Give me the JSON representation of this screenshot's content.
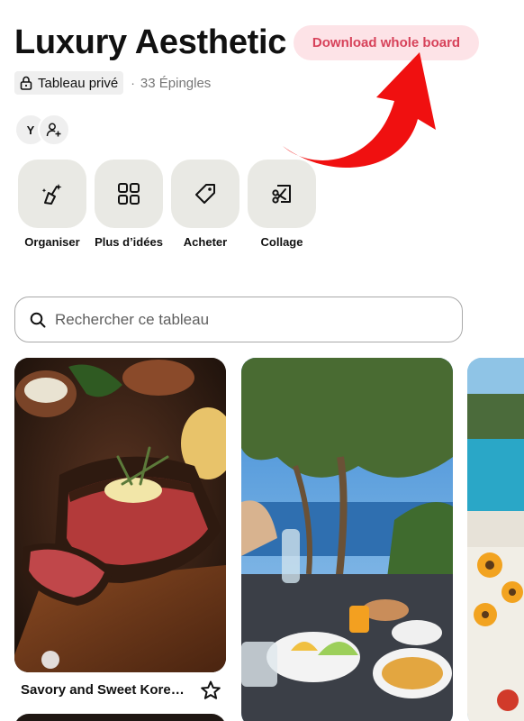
{
  "board": {
    "title": "Luxury Aesthetic",
    "download_label": "Download whole board",
    "privacy_label": "Tableau privé",
    "separator": "·",
    "pin_count_label": "33 Épingles",
    "collaborator_initial": "Y"
  },
  "actions": [
    {
      "label": "Organiser",
      "icon": "sparkle-broom-icon"
    },
    {
      "label": "Plus d’idées",
      "icon": "grid-icon"
    },
    {
      "label": "Acheter",
      "icon": "tag-icon"
    },
    {
      "label": "Collage",
      "icon": "scissors-icon"
    }
  ],
  "search": {
    "placeholder": "Rechercher ce tableau",
    "value": ""
  },
  "pins": [
    {
      "title": "Savory and Sweet Korean...",
      "image": "steak-image"
    },
    {
      "title": "",
      "image": "mediterranean-breakfast-image"
    },
    {
      "title": "",
      "image": "pool-terrace-image"
    }
  ],
  "colors": {
    "download_bg": "#fde3e7",
    "download_text": "#d7425a",
    "annotation_arrow": "#f01010",
    "action_bg": "#e9e9e4"
  }
}
